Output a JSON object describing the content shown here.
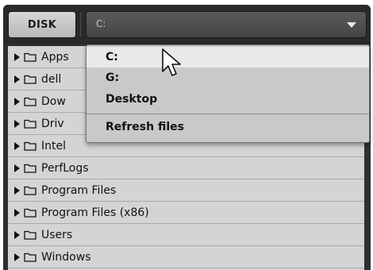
{
  "toolbar": {
    "disk_label": "DISK",
    "path_value": "C:"
  },
  "folders": [
    {
      "name": "Apps"
    },
    {
      "name": "dell"
    },
    {
      "name": "Dow"
    },
    {
      "name": "Driv"
    },
    {
      "name": "Intel"
    },
    {
      "name": "PerfLogs"
    },
    {
      "name": "Program Files"
    },
    {
      "name": "Program Files (x86)"
    },
    {
      "name": "Users"
    },
    {
      "name": "Windows"
    }
  ],
  "dropdown": {
    "items": [
      {
        "label": "C:",
        "hover": true
      },
      {
        "label": "G:"
      },
      {
        "label": "Desktop"
      },
      {
        "label": "Refresh files"
      }
    ]
  },
  "colors": {
    "panel_bg": "#2f2f2f",
    "list_bg": "#d3d3d3",
    "dropdown_bg": "#c9c9c9",
    "hover_bg": "#e9e9e9"
  },
  "icons": {
    "row_expand": "triangle-right-icon",
    "row_folder": "folder-icon",
    "select_caret": "chevron-down-icon",
    "pointer": "mouse-pointer-icon"
  }
}
